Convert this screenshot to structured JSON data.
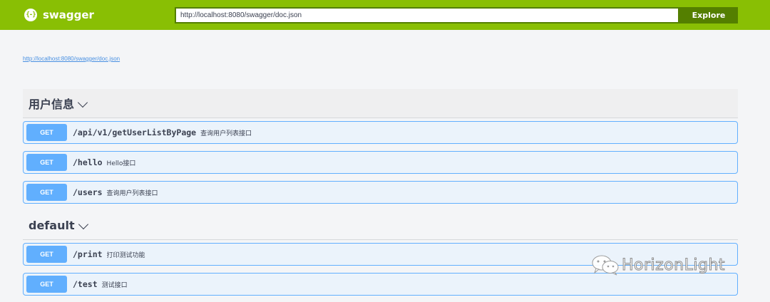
{
  "header": {
    "logo_glyph": "{-}",
    "logo_text": "swagger",
    "url_value": "http://localhost:8080/swagger/doc.json",
    "explore_label": "Explore",
    "brand_color": "#89bf04",
    "dark_color": "#547f00"
  },
  "spec_link": "http://localhost:8080/swagger/doc.json",
  "tags": [
    {
      "name": "用户信息",
      "operations": [
        {
          "method": "GET",
          "path": "/api/v1/getUserListByPage",
          "summary": "查询用户列表接口"
        },
        {
          "method": "GET",
          "path": "/hello",
          "summary": "Hello接口"
        },
        {
          "method": "GET",
          "path": "/users",
          "summary": "查询用户列表接口"
        }
      ]
    },
    {
      "name": "default",
      "operations": [
        {
          "method": "GET",
          "path": "/print",
          "summary": "打印测试功能"
        },
        {
          "method": "GET",
          "path": "/test",
          "summary": "测试接口"
        }
      ]
    }
  ],
  "watermark": {
    "text": "HorizonLight",
    "icon": "wechat-icon"
  }
}
